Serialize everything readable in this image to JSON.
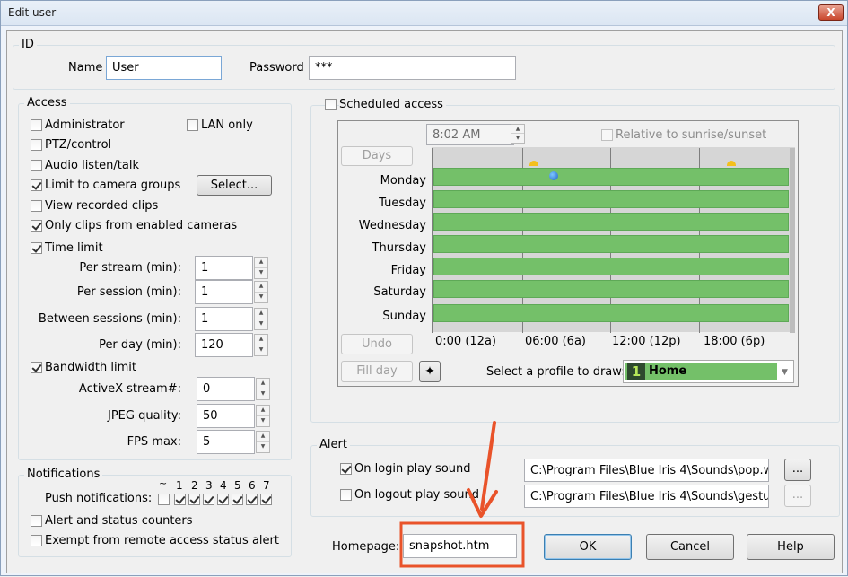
{
  "window": {
    "title": "Edit user",
    "close_label": "X"
  },
  "id_group": {
    "title": "ID",
    "name_label": "Name",
    "name_value": "User",
    "password_label": "Password",
    "password_value": "***"
  },
  "access": {
    "title": "Access",
    "administrator": "Administrator",
    "lan_only": "LAN only",
    "ptz": "PTZ/control",
    "audio": "Audio listen/talk",
    "limit_groups": "Limit to camera groups",
    "select_button": "Select...",
    "view_clips": "View recorded clips",
    "only_clips": "Only clips from enabled cameras",
    "time_limit": "Time limit",
    "per_stream_label": "Per stream (min):",
    "per_stream_value": "1",
    "per_session_label": "Per session (min):",
    "per_session_value": "1",
    "between_label": "Between sessions (min):",
    "between_value": "1",
    "per_day_label": "Per day (min):",
    "per_day_value": "120",
    "bandwidth": "Bandwidth limit",
    "activex_label": "ActiveX stream#:",
    "activex_value": "0",
    "jpeg_label": "JPEG quality:",
    "jpeg_value": "50",
    "fps_label": "FPS max:",
    "fps_value": "5"
  },
  "notifications": {
    "title": "Notifications",
    "tilde": "~",
    "day_numbers": [
      "1",
      "2",
      "3",
      "4",
      "5",
      "6",
      "7"
    ],
    "push_label": "Push notifications:",
    "alert_counters": "Alert and status counters",
    "exempt": "Exempt from remote access status alert"
  },
  "schedule": {
    "title": "Scheduled access",
    "time_value": "8:02 AM",
    "relative": "Relative to sunrise/sunset",
    "days_button": "Days",
    "days": [
      "Monday",
      "Tuesday",
      "Wednesday",
      "Thursday",
      "Friday",
      "Saturday",
      "Sunday"
    ],
    "hour_labels": [
      "0:00 (12a)",
      "06:00 (6a)",
      "12:00 (12p)",
      "18:00 (6p)"
    ],
    "undo_button": "Undo",
    "fill_day_button": "Fill day",
    "profile_label": "Select a profile to draw:",
    "profile_number": "1",
    "profile_value": "Home",
    "bar_color": "#74c069"
  },
  "alert": {
    "title": "Alert",
    "login_label": "On login play sound",
    "login_path": "C:\\Program Files\\Blue Iris 4\\Sounds\\pop.w",
    "logout_label": "On logout play sound",
    "logout_path": "C:\\Program Files\\Blue Iris 4\\Sounds\\gestur",
    "browse_label": "..."
  },
  "homepage": {
    "label": "Homepage:",
    "value": "snapshot.htm"
  },
  "buttons": {
    "ok": "OK",
    "cancel": "Cancel",
    "help": "Help"
  },
  "annotation_color": "#e9532a"
}
